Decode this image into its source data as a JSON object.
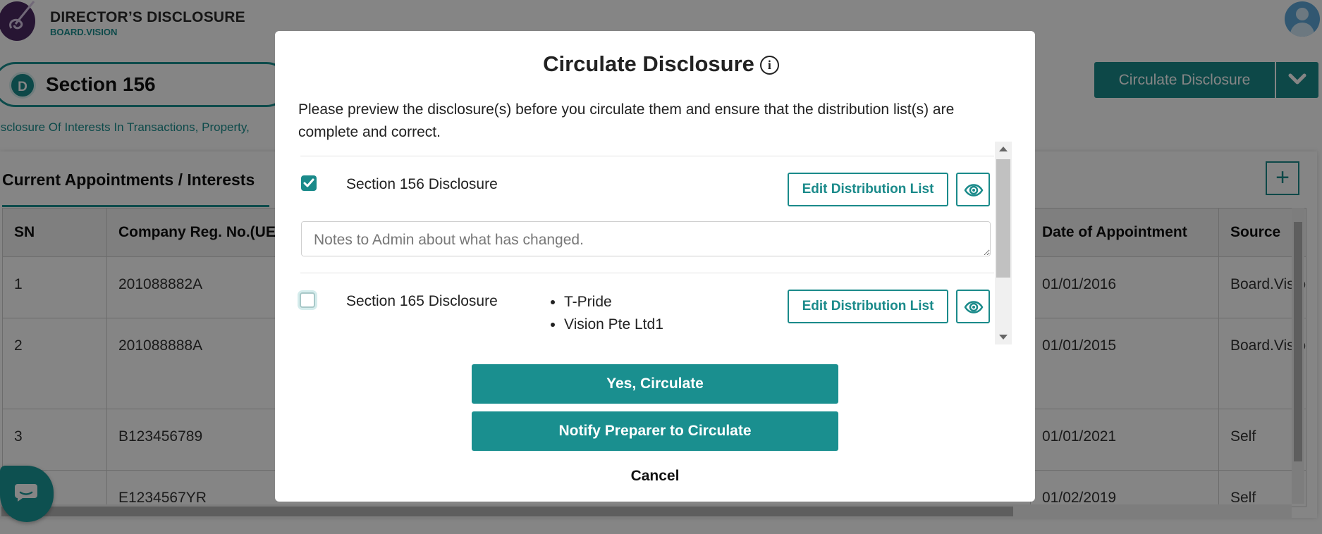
{
  "app": {
    "title": "DIRECTOR’S DISCLOSURE",
    "subtitle": "BOARD.VISION"
  },
  "section": {
    "badge": "D",
    "title": "Section 156",
    "description": "isclosure Of Interests In Transactions, Property,"
  },
  "header_actions": {
    "circulate_label": "Circulate Disclosure",
    "dropdown_icon": "chevron-down-icon"
  },
  "tab": {
    "title": "Current Appointments / Interests",
    "add_icon": "plus-icon"
  },
  "table": {
    "columns": [
      "SN",
      "Company Reg. No.(UE",
      "Date of Appointment",
      "Source"
    ],
    "rows": [
      [
        "1",
        "201088882A",
        "01/01/2016",
        "Board.Visio"
      ],
      [
        "2",
        "201088888A",
        "01/01/2015",
        "Board.Visio"
      ],
      [
        "3",
        "B123456789",
        "01/01/2021",
        "Self"
      ],
      [
        "",
        "E1234567YR",
        "01/02/2019",
        "Self"
      ]
    ]
  },
  "modal": {
    "title": "Circulate Disclosure",
    "info_icon": "i",
    "intro": "Please preview the disclosure(s) before you circulate them and ensure that the distribution list(s) are complete and correct.",
    "items": [
      {
        "label": "Section 156 Disclosure",
        "checked": true,
        "edit_label": "Edit Distribution List",
        "notes_placeholder": "Notes to Admin about what has changed."
      },
      {
        "label": "Section 165 Disclosure",
        "checked": false,
        "edit_label": "Edit Distribution List",
        "companies": [
          "T-Pride",
          "Vision Pte Ltd1"
        ]
      }
    ],
    "yes_label": "Yes, Circulate",
    "notify_label": "Notify Preparer to Circulate",
    "cancel_label": "Cancel"
  },
  "colors": {
    "accent": "#1a8f8f",
    "overlay": "rgba(0,0,0,0.48)",
    "logo": "#4b2a63"
  }
}
